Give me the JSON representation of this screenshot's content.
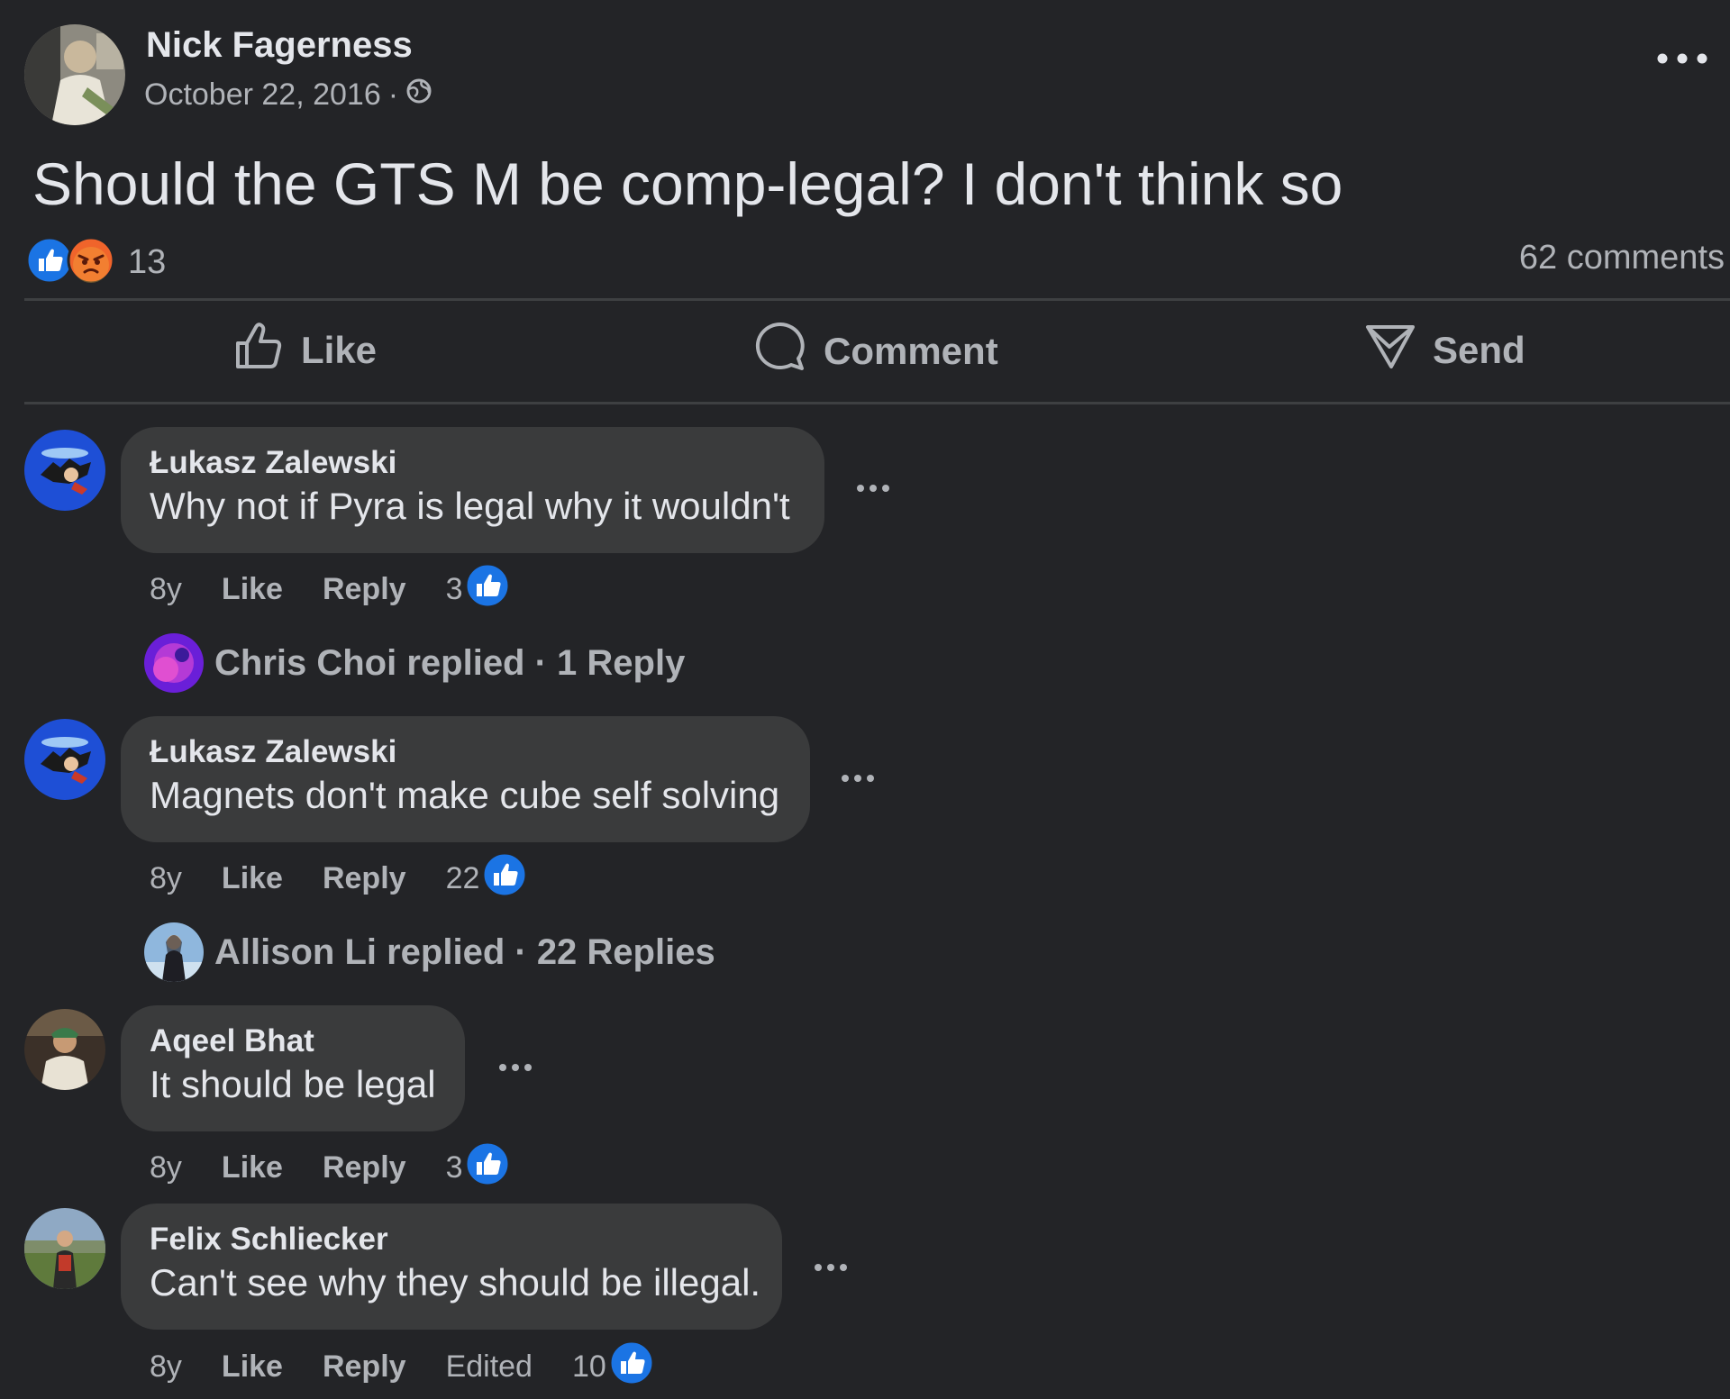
{
  "post": {
    "author": "Nick Fagerness",
    "date": "October 22, 2016",
    "separator": "·",
    "text": "Should the GTS M be comp-legal? I don't think so",
    "reaction_count": "13",
    "comments_count": "62 comments",
    "reactions": [
      "like-reaction-icon",
      "angry-reaction-icon"
    ]
  },
  "actions": {
    "like": "Like",
    "comment": "Comment",
    "send": "Send"
  },
  "comments": [
    {
      "author": "Łukasz Zalewski",
      "text": "Why not if Pyra is legal why it wouldn't",
      "age": "8y",
      "like_label": "Like",
      "reply_label": "Reply",
      "edited": "",
      "likes": "3",
      "reply_summary": "Chris Choi replied · 1 Reply"
    },
    {
      "author": "Łukasz Zalewski",
      "text": "Magnets don't make cube self solving",
      "age": "8y",
      "like_label": "Like",
      "reply_label": "Reply",
      "edited": "",
      "likes": "22",
      "reply_summary": "Allison Li replied · 22 Replies"
    },
    {
      "author": "Aqeel Bhat",
      "text": "It should be legal",
      "age": "8y",
      "like_label": "Like",
      "reply_label": "Reply",
      "edited": "",
      "likes": "3",
      "reply_summary": ""
    },
    {
      "author": "Felix Schliecker",
      "text": "Can't see why they should be illegal.",
      "age": "8y",
      "like_label": "Like",
      "reply_label": "Reply",
      "edited": "Edited",
      "likes": "10",
      "reply_summary": ""
    }
  ],
  "colors": {
    "background": "#232427",
    "bubble": "#3a3b3c",
    "like_blue": "#1b74e4",
    "angry_orange": "#f0642b",
    "secondary_text": "#b0b3b8"
  }
}
